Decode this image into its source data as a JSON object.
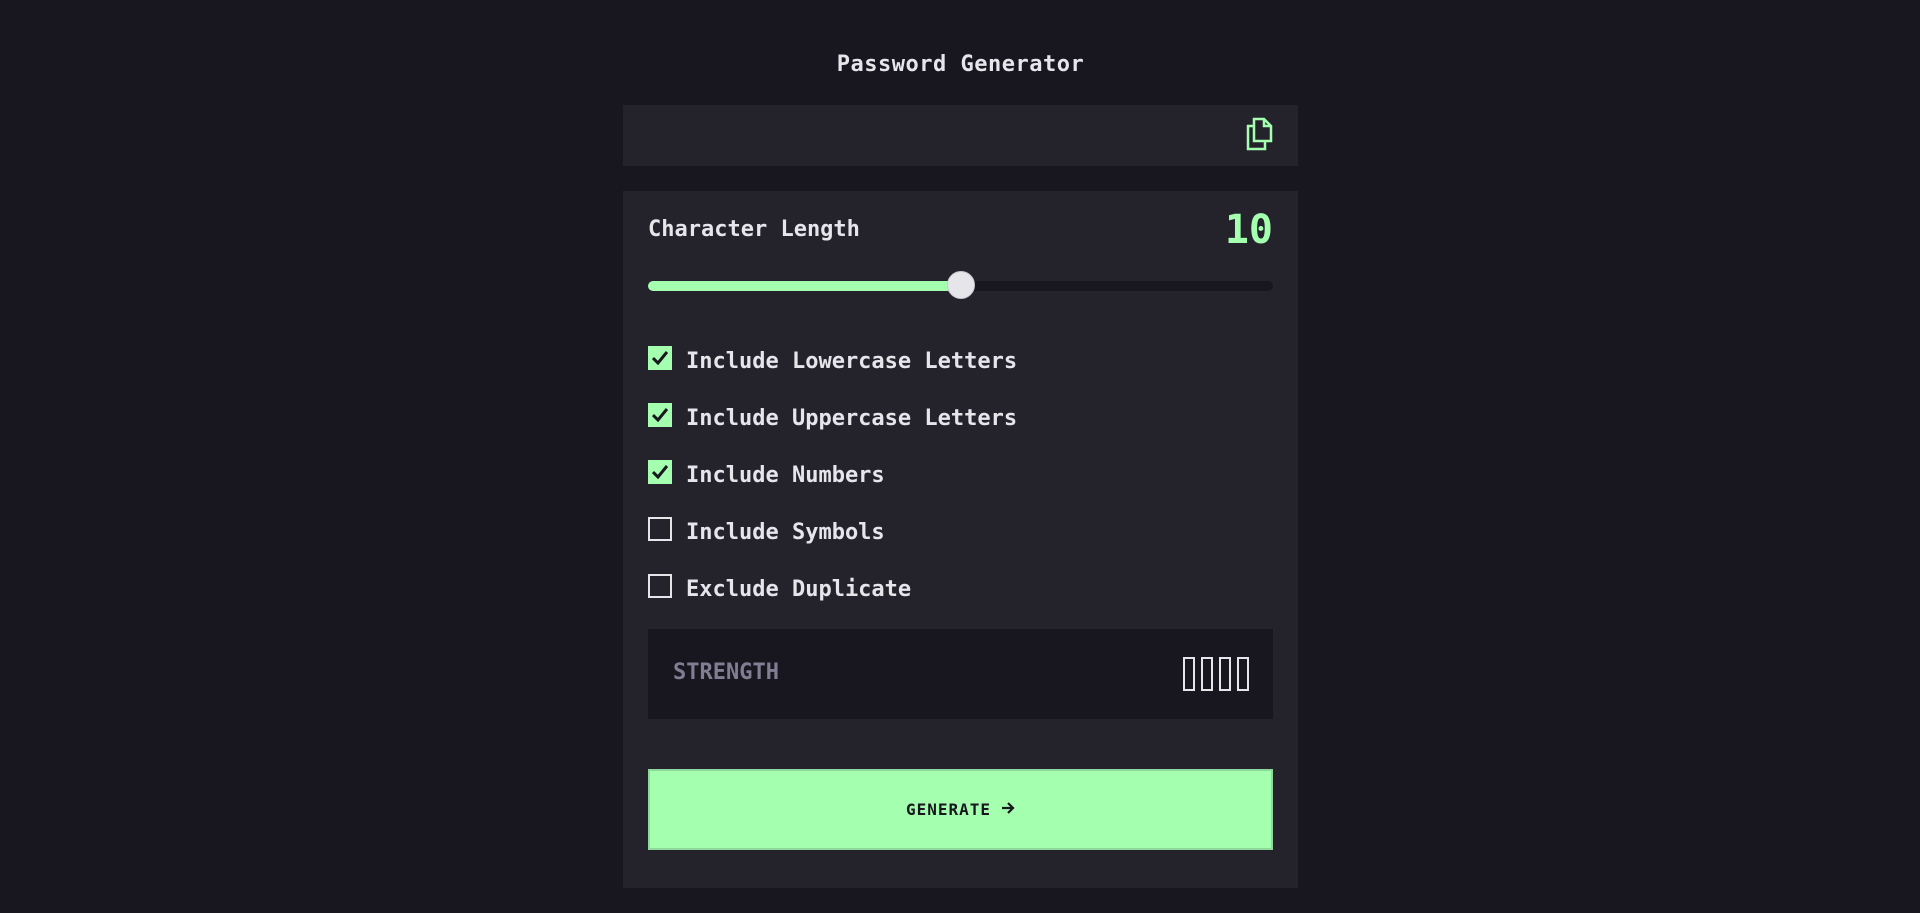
{
  "app": {
    "title": "Password Generator"
  },
  "output": {
    "password": "",
    "copy_icon": "copy-icon"
  },
  "length": {
    "label": "Character Length",
    "value": "10",
    "slider_fraction": 0.5
  },
  "options": [
    {
      "label": "Include Lowercase Letters",
      "checked": true
    },
    {
      "label": "Include Uppercase Letters",
      "checked": true
    },
    {
      "label": "Include Numbers",
      "checked": true
    },
    {
      "label": "Include Symbols",
      "checked": false
    },
    {
      "label": "Exclude Duplicate",
      "checked": false
    }
  ],
  "strength": {
    "label": "STRENGTH",
    "bars_filled": 0,
    "bars_total": 4
  },
  "generate": {
    "label": "GENERATE",
    "icon": "arrow-right-icon"
  },
  "colors": {
    "accent": "#a4ffaf",
    "background": "#18171f",
    "panel": "#24232c",
    "muted": "#817d92"
  }
}
